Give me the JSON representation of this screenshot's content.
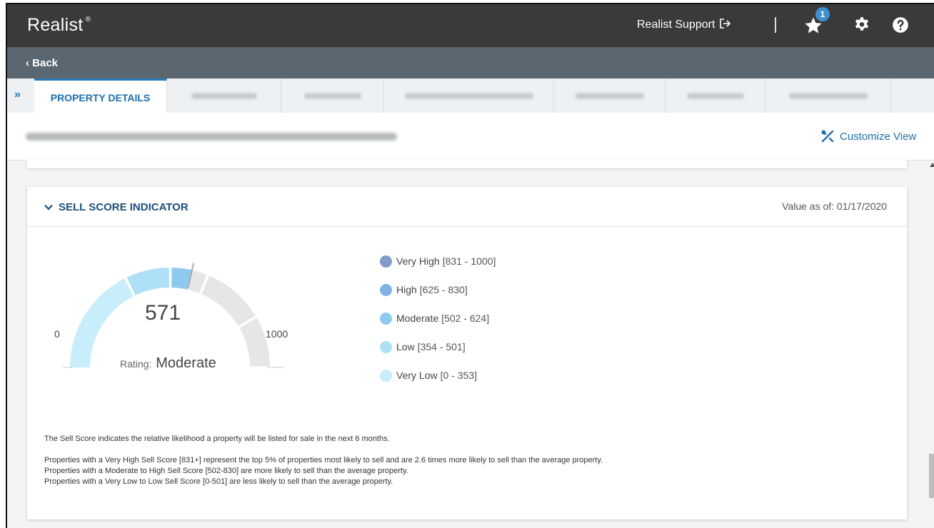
{
  "header": {
    "brand": "Realist",
    "brand_mark": "®",
    "support_label": "Realist Support",
    "favorites_badge": "1"
  },
  "nav": {
    "back_label": "‹ Back"
  },
  "tabs": [
    {
      "label": "PROPERTY DETAILS",
      "active": true
    },
    {
      "label": "",
      "active": false
    },
    {
      "label": "",
      "active": false
    },
    {
      "label": "",
      "active": false
    },
    {
      "label": "",
      "active": false
    },
    {
      "label": "",
      "active": false
    },
    {
      "label": "",
      "active": false
    }
  ],
  "toolbar": {
    "customize_label": "Customize View"
  },
  "sell_score": {
    "title": "SELL SCORE INDICATOR",
    "value_as_of": "Value as of: 01/17/2020",
    "score": "571",
    "score_value": 571,
    "min_label": "0",
    "max_label": "1000",
    "rating_label": "Rating:",
    "rating_value": "Moderate",
    "legend": [
      {
        "name": "Very High",
        "range": "[831 - 1000]",
        "color": "#7f9ccb"
      },
      {
        "name": "High",
        "range": "[625 - 830]",
        "color": "#7fb2e2"
      },
      {
        "name": "Moderate",
        "range": "[502 - 624]",
        "color": "#8ecaf0"
      },
      {
        "name": "Low",
        "range": "[354 - 501]",
        "color": "#aee0f7"
      },
      {
        "name": "Very Low",
        "range": "[0 - 353]",
        "color": "#c8edfb"
      }
    ],
    "notes": {
      "line1": "The Sell Score indicates the relative likelihood a property will be listed for sale in the next 6 months.",
      "line2": "Properties with a Very High Sell Score [831+] represent the top 5% of properties most likely to sell and are 2.6 times more likely to sell than the average property.",
      "line3": "Properties with a Moderate to High Sell Score [502-830] are more likely to sell than the average property.",
      "line4": "Properties with a Very Low to Low Sell Score [0-501] are less likely to sell than the average property."
    }
  },
  "colors": {
    "topbar": "#3a3a3a",
    "backbar": "#5b6770",
    "accent": "#2a7ab8",
    "gauge_empty": "#e6e6e6"
  }
}
